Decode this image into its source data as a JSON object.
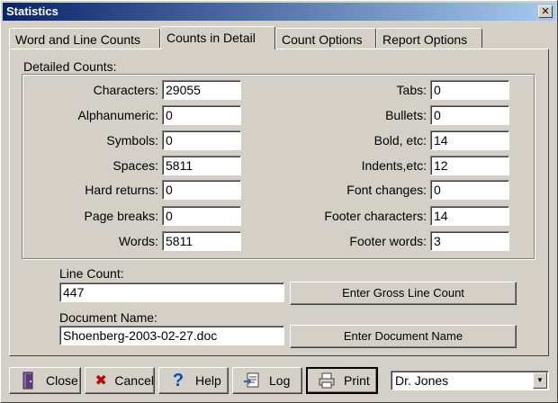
{
  "window": {
    "title": "Statistics",
    "close_glyph": "✕"
  },
  "tabs": [
    {
      "label": "Word and Line Counts"
    },
    {
      "label": "Counts in Detail"
    },
    {
      "label": "Count Options"
    },
    {
      "label": "Report Options"
    }
  ],
  "detailed": {
    "group_label": "Detailed Counts:",
    "left": [
      {
        "label": "Characters:",
        "value": "29055"
      },
      {
        "label": "Alphanumeric:",
        "value": "0"
      },
      {
        "label": "Symbols:",
        "value": "0"
      },
      {
        "label": "Spaces:",
        "value": "5811"
      },
      {
        "label": "Hard returns:",
        "value": "0"
      },
      {
        "label": "Page breaks:",
        "value": "0"
      },
      {
        "label": "Words:",
        "value": "5811"
      }
    ],
    "right": [
      {
        "label": "Tabs:",
        "value": "0"
      },
      {
        "label": "Bullets:",
        "value": "0"
      },
      {
        "label": "Bold, etc:",
        "value": "14"
      },
      {
        "label": "Indents,etc:",
        "value": "12"
      },
      {
        "label": "Font changes:",
        "value": "0"
      },
      {
        "label": "Footer characters:",
        "value": "14"
      },
      {
        "label": "Footer words:",
        "value": "3"
      }
    ]
  },
  "line_count": {
    "label": "Line Count:",
    "value": "447",
    "button": "Enter Gross Line Count"
  },
  "document_name": {
    "label": "Document Name:",
    "value": "Shoenberg-2003-02-27.doc",
    "button": "Enter Document Name"
  },
  "bottom": {
    "close": "Close",
    "cancel": "Cancel",
    "help": "Help",
    "log": "Log",
    "print": "Print",
    "user": "Dr. Jones"
  },
  "icons": {
    "close": "door-icon",
    "cancel": "x-mark-icon",
    "help": "question-mark-icon",
    "log": "log-icon",
    "print": "printer-icon"
  },
  "colors": {
    "title_start": "#0a246a",
    "title_end": "#a6caf0",
    "cancel_red": "#c00000",
    "help_blue": "#0050c0"
  }
}
